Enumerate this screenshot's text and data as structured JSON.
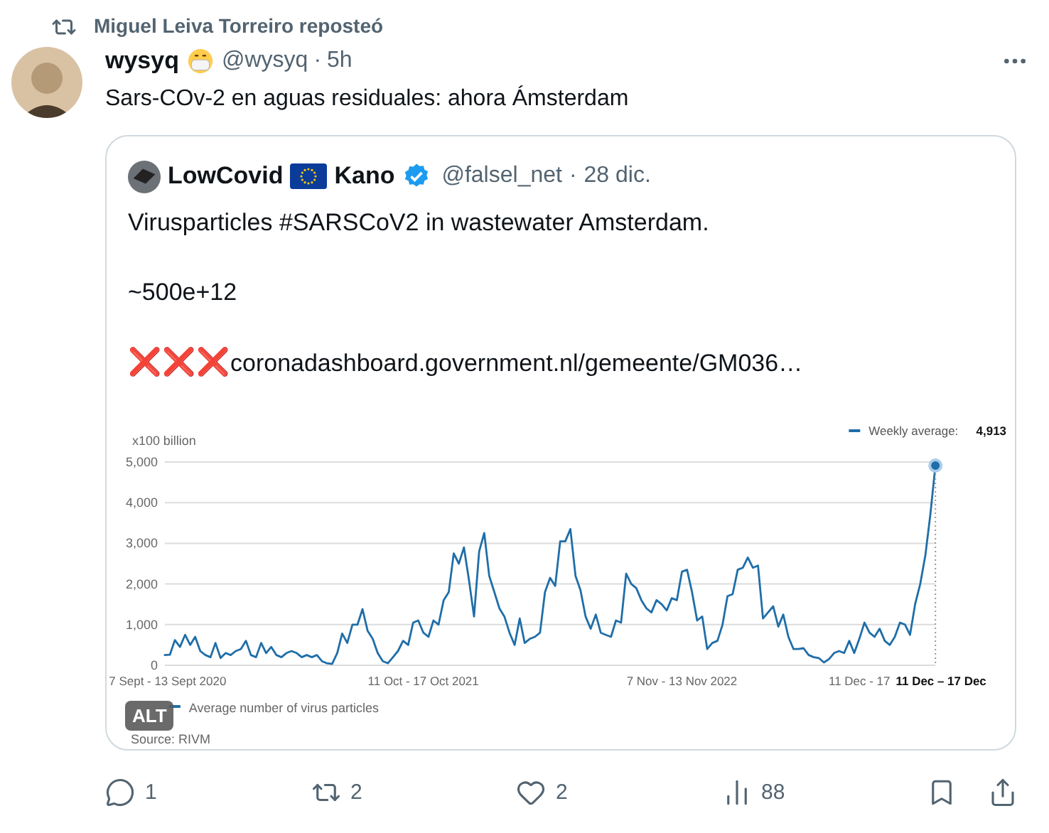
{
  "repost": {
    "text": "Miguel Leiva Torreiro reposteó"
  },
  "tweet": {
    "name": "wysyq",
    "handle": "@wysyq",
    "separator": "·",
    "time": "5h",
    "text": "Sars-COv-2 en aguas residuales: ahora Ámsterdam",
    "quote": {
      "name": "LowCovid",
      "name_2": "Kano",
      "verified": true,
      "handle": "@falsel_net",
      "separator": "·",
      "time": "28 dic.",
      "lines": [
        "Virusparticles #SARSCoV2 in wastewater Amsterdam.",
        "~500e+12"
      ],
      "link_marks": "❌❌❌",
      "link": "coronadashboard.government.nl/gemeente/GM036…",
      "media": {
        "alt_badge": "ALT",
        "source": "Source: RIVM",
        "chart_data": {
          "type": "line",
          "ylabel": "x100 billion",
          "ylim": [
            0,
            5000
          ],
          "grid": true,
          "categories": [
            "7 Sept - 13 Sept 2020",
            null,
            null,
            null,
            null,
            null,
            null,
            null,
            null,
            null,
            null,
            null,
            null,
            null,
            null,
            null,
            null,
            null,
            null,
            null,
            null,
            null,
            null,
            null,
            null,
            null,
            null,
            null,
            null,
            null,
            null,
            null,
            null,
            null,
            null,
            null,
            null,
            null,
            null,
            null,
            null,
            null,
            null,
            null,
            null,
            null,
            null,
            null,
            null,
            null,
            null,
            "11 Oct - 17 Oct 2021",
            null,
            null,
            null,
            null,
            null,
            null,
            null,
            null,
            null,
            null,
            null,
            null,
            null,
            null,
            null,
            null,
            null,
            null,
            null,
            null,
            null,
            null,
            null,
            null,
            null,
            null,
            null,
            null,
            null,
            null,
            null,
            null,
            null,
            null,
            null,
            null,
            null,
            null,
            null,
            null,
            null,
            null,
            null,
            null,
            null,
            null,
            null,
            null,
            null,
            null,
            "7 Nov - 13 Nov 2022",
            null,
            null,
            null,
            null,
            null,
            null,
            null,
            null,
            null,
            null,
            null,
            null,
            null,
            null,
            null,
            null,
            null,
            null,
            null,
            null,
            null,
            null,
            null,
            null,
            null,
            null,
            null,
            null,
            null,
            null,
            null,
            null,
            null,
            null,
            "11 Dec - 17",
            null,
            null,
            null,
            null,
            null,
            null,
            null,
            null,
            null,
            null,
            null,
            null,
            null,
            null,
            "11 Dec – 17 Dec"
          ],
          "yticks": [
            {
              "value": 0,
              "label": "0"
            },
            {
              "value": 1000,
              "label": "1,000"
            },
            {
              "value": 2000,
              "label": "2,000"
            },
            {
              "value": 3000,
              "label": "3,000"
            },
            {
              "value": 4000,
              "label": "4,000"
            },
            {
              "value": 5000,
              "label": "5,000"
            }
          ],
          "series": [
            {
              "name": "Average number of virus particles",
              "color": "#1f6ea8",
              "values": [
                250,
                260,
                620,
                450,
                750,
                500,
                700,
                350,
                250,
                200,
                550,
                180,
                300,
                250,
                350,
                400,
                600,
                250,
                200,
                550,
                300,
                450,
                250,
                200,
                300,
                350,
                300,
                200,
                250,
                200,
                250,
                100,
                50,
                30,
                300,
                780,
                550,
                1000,
                1000,
                1380,
                850,
                650,
                300,
                100,
                50,
                200,
                350,
                600,
                500,
                1050,
                1100,
                800,
                700,
                1100,
                1000,
                1600,
                1800,
                2750,
                2500,
                2900,
                2100,
                1200,
                2800,
                3250,
                2200,
                1800,
                1400,
                1200,
                800,
                500,
                1150,
                550,
                650,
                700,
                800,
                1800,
                2150,
                1950,
                3050,
                3050,
                3350,
                2200,
                1850,
                1200,
                900,
                1250,
                800,
                750,
                700,
                1100,
                1050,
                2250,
                2000,
                1900,
                1600,
                1400,
                1300,
                1600,
                1500,
                1350,
                1650,
                1600,
                2300,
                2350,
                1800,
                1100,
                1200,
                400,
                550,
                600,
                1000,
                1700,
                1750,
                2350,
                2400,
                2650,
                2400,
                2450,
                1150,
                1300,
                1450,
                950,
                1250,
                700,
                400,
                400,
                420,
                250,
                200,
                180,
                70,
                150,
                300,
                350,
                300,
                600,
                300,
                650,
                1050,
                800,
                700,
                900,
                600,
                500,
                700,
                1050,
                1000,
                750,
                1500,
                2000,
                2700,
                3700,
                4913
              ]
            }
          ],
          "annotations": [
            {
              "text": "Weekly average:"
            },
            {
              "text": "4,913"
            }
          ]
        }
      }
    }
  },
  "actions": [
    {
      "kind": "reply",
      "count": "1"
    },
    {
      "kind": "repost",
      "count": "2"
    },
    {
      "kind": "like",
      "count": "2"
    },
    {
      "kind": "views",
      "count": "88"
    },
    {
      "kind": "bookmark"
    },
    {
      "kind": "share"
    }
  ]
}
